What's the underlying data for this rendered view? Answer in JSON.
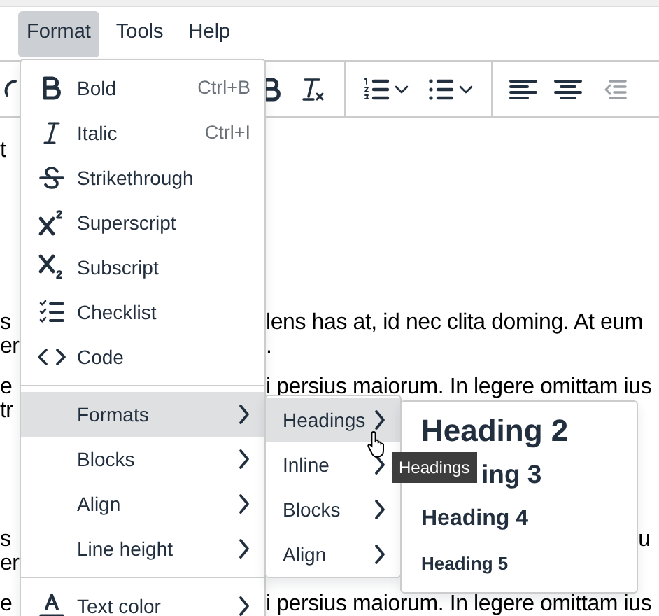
{
  "menubar": [
    {
      "label": "Format",
      "selected": true
    },
    {
      "label": "Tools",
      "selected": false
    },
    {
      "label": "Help",
      "selected": false
    }
  ],
  "toolbar": [
    {
      "kind": "button",
      "disabled": false
    },
    {
      "kind": "button",
      "disabled": false
    },
    {
      "kind": "button",
      "disabled": false
    },
    {
      "kind": "split",
      "disabled": false
    },
    {
      "kind": "split",
      "disabled": false
    },
    {
      "kind": "button",
      "disabled": false
    },
    {
      "kind": "button",
      "disabled": false
    },
    {
      "kind": "button",
      "disabled": true
    }
  ],
  "content": [
    {
      "lines": [
        {
          "left": "t"
        }
      ]
    },
    {
      "lines": [
        {
          "left": "s",
          "right": "lens has at, id nec clita doming. At eum"
        },
        {
          "left": "er",
          "right": "."
        }
      ]
    },
    {
      "lines": [
        {
          "left": "e",
          "right": "i persius maiorum. In legere omittam ius"
        },
        {
          "left": "tr"
        }
      ]
    },
    {
      "lines": [
        {
          "left": "s",
          "tail": "u"
        },
        {
          "left": "er"
        }
      ]
    },
    {
      "lines": [
        {
          "left": "e",
          "right": "i persius maiorum. In legere omittam ius"
        }
      ]
    }
  ],
  "format_menu": {
    "items": [
      {
        "kind": "command",
        "label": "Bold",
        "shortcut": "Ctrl+B"
      },
      {
        "kind": "command",
        "label": "Italic",
        "shortcut": "Ctrl+I"
      },
      {
        "kind": "command",
        "label": "Strikethrough"
      },
      {
        "kind": "command",
        "label": "Superscript"
      },
      {
        "kind": "command",
        "label": "Subscript"
      },
      {
        "kind": "command",
        "label": "Checklist"
      },
      {
        "kind": "command",
        "label": "Code"
      },
      {
        "kind": "divider"
      },
      {
        "kind": "submenu",
        "label": "Formats",
        "selected": true
      },
      {
        "kind": "submenu",
        "label": "Blocks",
        "selected": false
      },
      {
        "kind": "submenu",
        "label": "Align",
        "selected": false
      },
      {
        "kind": "submenu",
        "label": "Line height",
        "selected": false
      },
      {
        "kind": "divider"
      },
      {
        "kind": "submenu",
        "label": "Text color",
        "selected": false
      }
    ]
  },
  "formats_menu": {
    "items": [
      {
        "label": "Headings",
        "selected": true
      },
      {
        "label": "Inline",
        "selected": false
      },
      {
        "label": "Blocks",
        "selected": false
      },
      {
        "label": "Align",
        "selected": false
      }
    ]
  },
  "headings_menu": {
    "items": [
      {
        "kind": "heading2",
        "label": "Heading 2"
      },
      {
        "kind": "heading3",
        "label": "ing 3"
      },
      {
        "kind": "heading4",
        "label": "Heading 4"
      },
      {
        "kind": "heading5",
        "label": "Heading 5"
      }
    ]
  },
  "tooltip": {
    "text": "Headings"
  }
}
